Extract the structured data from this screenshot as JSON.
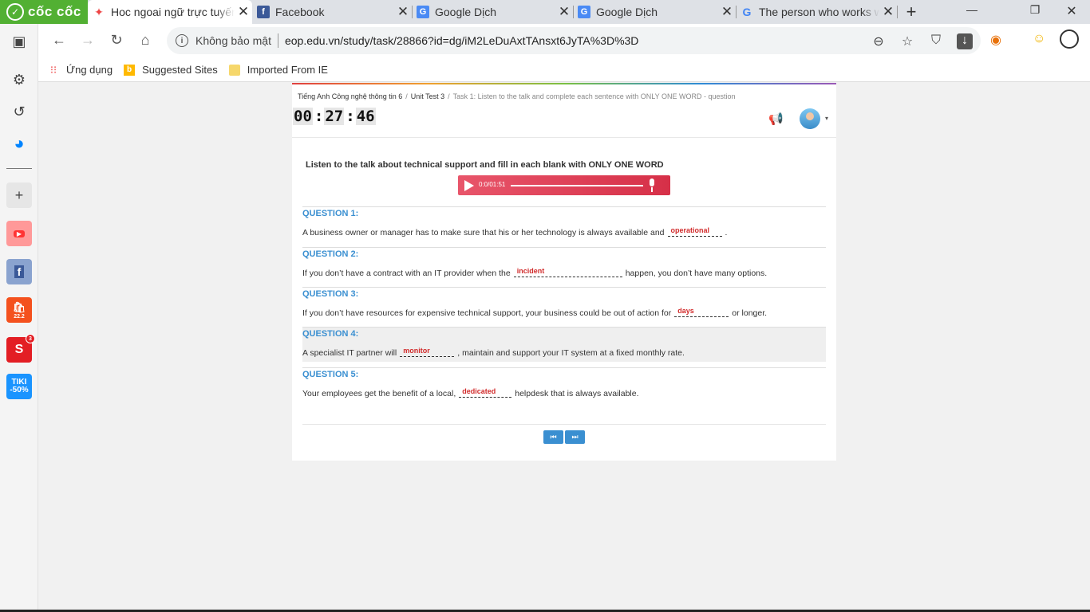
{
  "browser": {
    "brand": "cốc cốc",
    "tabs": [
      {
        "title": "Hoc ngoai ngữ trực tuyến",
        "active": true
      },
      {
        "title": "Facebook",
        "active": false
      },
      {
        "title": "Google Dịch",
        "active": false
      },
      {
        "title": "Google Dịch",
        "active": false
      },
      {
        "title": "The person who works w",
        "active": false
      }
    ],
    "security_label": "Không bảo mật",
    "url": "eop.edu.vn/study/task/28866?id=dg/iM2LeDuAxtTAnsxt6JyTA%3D%3D",
    "bookmarks": [
      {
        "label": "Ứng dụng",
        "icon": "apps-grid-icon"
      },
      {
        "label": "Suggested Sites",
        "icon": "bing-icon"
      },
      {
        "label": "Imported From IE",
        "icon": "folder-icon"
      }
    ]
  },
  "sidebar": {
    "items": [
      {
        "name": "youtube",
        "color": "#f55"
      },
      {
        "name": "facebook",
        "color": "#3b5998"
      },
      {
        "name": "shopee",
        "color": "#f4511e",
        "text": "22.2"
      },
      {
        "name": "sendo",
        "color": "#e31e24",
        "badge": "3"
      },
      {
        "name": "tiki",
        "color": "#1a94ff",
        "text": "TIKI -50%"
      }
    ]
  },
  "page": {
    "breadcrumbs": [
      "Tiếng Anh Công nghệ thông tin 6",
      "Unit Test 3",
      "Task 1: Listen to the talk and complete each sentence with ONLY ONE WORD - question"
    ],
    "timer": {
      "h": "00",
      "m": "27",
      "s": "46"
    },
    "instruction": "Listen to the talk about technical support and fill in each blank with ONLY ONE WORD",
    "audio": {
      "time": "0:0/01:51",
      "progress": 0
    },
    "questions": [
      {
        "title": "QUESTION 1:",
        "before": "A business owner or manager has to make sure that his or her technology is always available and",
        "answer": "operational",
        "after": "."
      },
      {
        "title": "QUESTION 2:",
        "before": "If you don’t have a contract with an IT provider when the",
        "answer": "incident",
        "after": "happen, you don’t have many options."
      },
      {
        "title": "QUESTION 3:",
        "before": "If you don’t have resources for expensive technical support, your business could be out of action for",
        "answer": "days",
        "after": "or longer."
      },
      {
        "title": "QUESTION 4:",
        "before": "A specialist IT partner will",
        "answer": "monitor",
        "after": ", maintain and support your IT system at a fixed monthly rate."
      },
      {
        "title": "QUESTION 5:",
        "before": "Your employees get the benefit of a local,",
        "answer": "dedicated",
        "after": "helpdesk that is always available."
      }
    ]
  }
}
